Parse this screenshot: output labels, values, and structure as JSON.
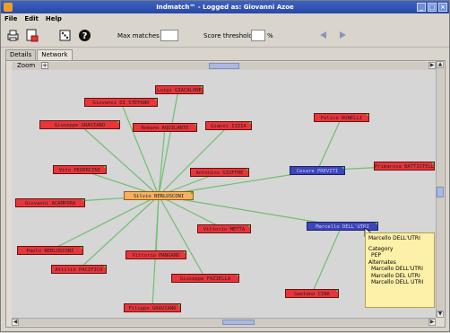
{
  "window": {
    "title": "Indmatch™ - Logged as: Giovanni Azoe"
  },
  "menu": {
    "file": "File",
    "edit": "Edit",
    "help": "Help"
  },
  "toolbar": {
    "max_matches_label": "Max matches",
    "max_matches_value": "",
    "score_threshold_label": "Score threshold",
    "score_threshold_value": "",
    "percent_sign": "%"
  },
  "tabs": [
    {
      "label": "Details"
    },
    {
      "label": "Network"
    }
  ],
  "zoom": {
    "label": "Zoom",
    "plus": "+"
  },
  "colors": {
    "person": "#e8353a",
    "center": "#f4b25e",
    "selected": "#3e45b8",
    "edge": "#6fbf6f"
  },
  "nodes": {
    "luigi": "Luigi GIACALONE",
    "giovanni_ds": "Giovanni DI STEFANO",
    "giuseppe_g": "Giuseppe GRAVIANO",
    "romano": "Romano AQUILANTE",
    "gianni": "Gianni IZZIA",
    "vito": "Vito PEDERCINI",
    "antonino": "Antonino GIUFFRE",
    "giovanni_a": "Giovanni ACAMPORA",
    "silvio": "Silvio BERLUSCONI",
    "paolo": "Paolo BERLUSCONI",
    "vittorio_m": "Vittorio MANGANO",
    "vittorio": "Vittorio METTA",
    "attilio": "Attilio PACIFICO",
    "giuseppe_f": "Giuseppe FAZIELLA",
    "filippo": "Filippo GRAVIANO",
    "felice": "Felice RUNELLI",
    "cesare": "Cesare PREVITI",
    "primarosa": "Primarosa BATTISTELLA",
    "marcello": "Marcello DELL'UTRI",
    "gaetano": "Gaetano CINA"
  },
  "tooltip": {
    "name": "Marcello DELL'UTRI",
    "category_label": "Category",
    "category_value": "PEP",
    "alternates_label": "Alternates",
    "alternates": [
      "Marcello DELL'UTRI",
      "Marcello DEL UTRI",
      "Marcello DELL UTRI"
    ]
  },
  "scroll": {
    "up": "▲",
    "down": "▼",
    "left": "◀",
    "right": "▶"
  }
}
